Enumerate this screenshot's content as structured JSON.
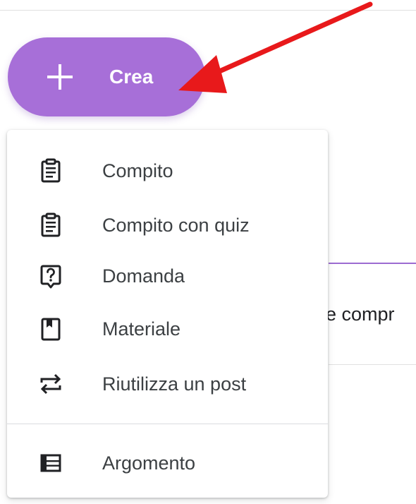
{
  "create_button": {
    "label": "Crea",
    "color": "#a76fd8"
  },
  "menu": {
    "items": [
      {
        "label": "Compito",
        "icon": "assignment-icon"
      },
      {
        "label": "Compito con quiz",
        "icon": "quiz-assignment-icon"
      },
      {
        "label": "Domanda",
        "icon": "question-icon"
      },
      {
        "label": "Materiale",
        "icon": "material-icon"
      },
      {
        "label": "Riutilizza un post",
        "icon": "reuse-icon"
      }
    ],
    "topic": {
      "label": "Argomento",
      "icon": "topic-icon"
    }
  },
  "background": {
    "partial_text": "e compr"
  },
  "annotation": {
    "arrow_color": "#e8191b"
  }
}
